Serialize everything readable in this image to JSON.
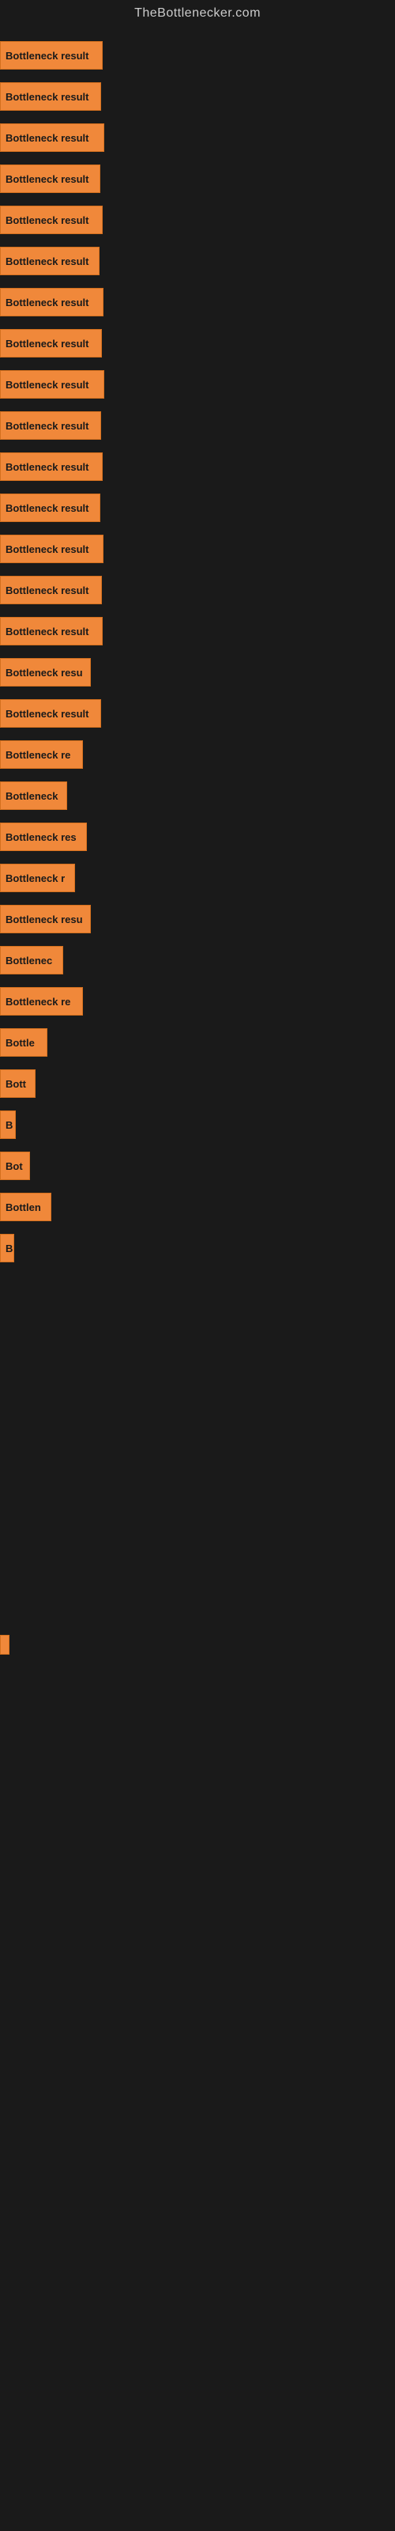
{
  "site": {
    "title": "TheBottlenecker.com"
  },
  "bars": [
    {
      "label": "Bottleneck result",
      "width": 130
    },
    {
      "label": "Bottleneck result",
      "width": 128
    },
    {
      "label": "Bottleneck result",
      "width": 132
    },
    {
      "label": "Bottleneck result",
      "width": 127
    },
    {
      "label": "Bottleneck result",
      "width": 130
    },
    {
      "label": "Bottleneck result",
      "width": 126
    },
    {
      "label": "Bottleneck result",
      "width": 131
    },
    {
      "label": "Bottleneck result",
      "width": 129
    },
    {
      "label": "Bottleneck result",
      "width": 132
    },
    {
      "label": "Bottleneck result",
      "width": 128
    },
    {
      "label": "Bottleneck result",
      "width": 130
    },
    {
      "label": "Bottleneck result",
      "width": 127
    },
    {
      "label": "Bottleneck result",
      "width": 131
    },
    {
      "label": "Bottleneck result",
      "width": 129
    },
    {
      "label": "Bottleneck result",
      "width": 130
    },
    {
      "label": "Bottleneck resu",
      "width": 115
    },
    {
      "label": "Bottleneck result",
      "width": 128
    },
    {
      "label": "Bottleneck re",
      "width": 105
    },
    {
      "label": "Bottleneck",
      "width": 85
    },
    {
      "label": "Bottleneck res",
      "width": 110
    },
    {
      "label": "Bottleneck r",
      "width": 95
    },
    {
      "label": "Bottleneck resu",
      "width": 115
    },
    {
      "label": "Bottlenec",
      "width": 80
    },
    {
      "label": "Bottleneck re",
      "width": 105
    },
    {
      "label": "Bottle",
      "width": 60
    },
    {
      "label": "Bott",
      "width": 45
    },
    {
      "label": "B",
      "width": 20
    },
    {
      "label": "Bot",
      "width": 38
    },
    {
      "label": "Bottlen",
      "width": 65
    },
    {
      "label": "B",
      "width": 18
    }
  ],
  "labels": {
    "bottleneck_result": "Bottleneck result"
  }
}
